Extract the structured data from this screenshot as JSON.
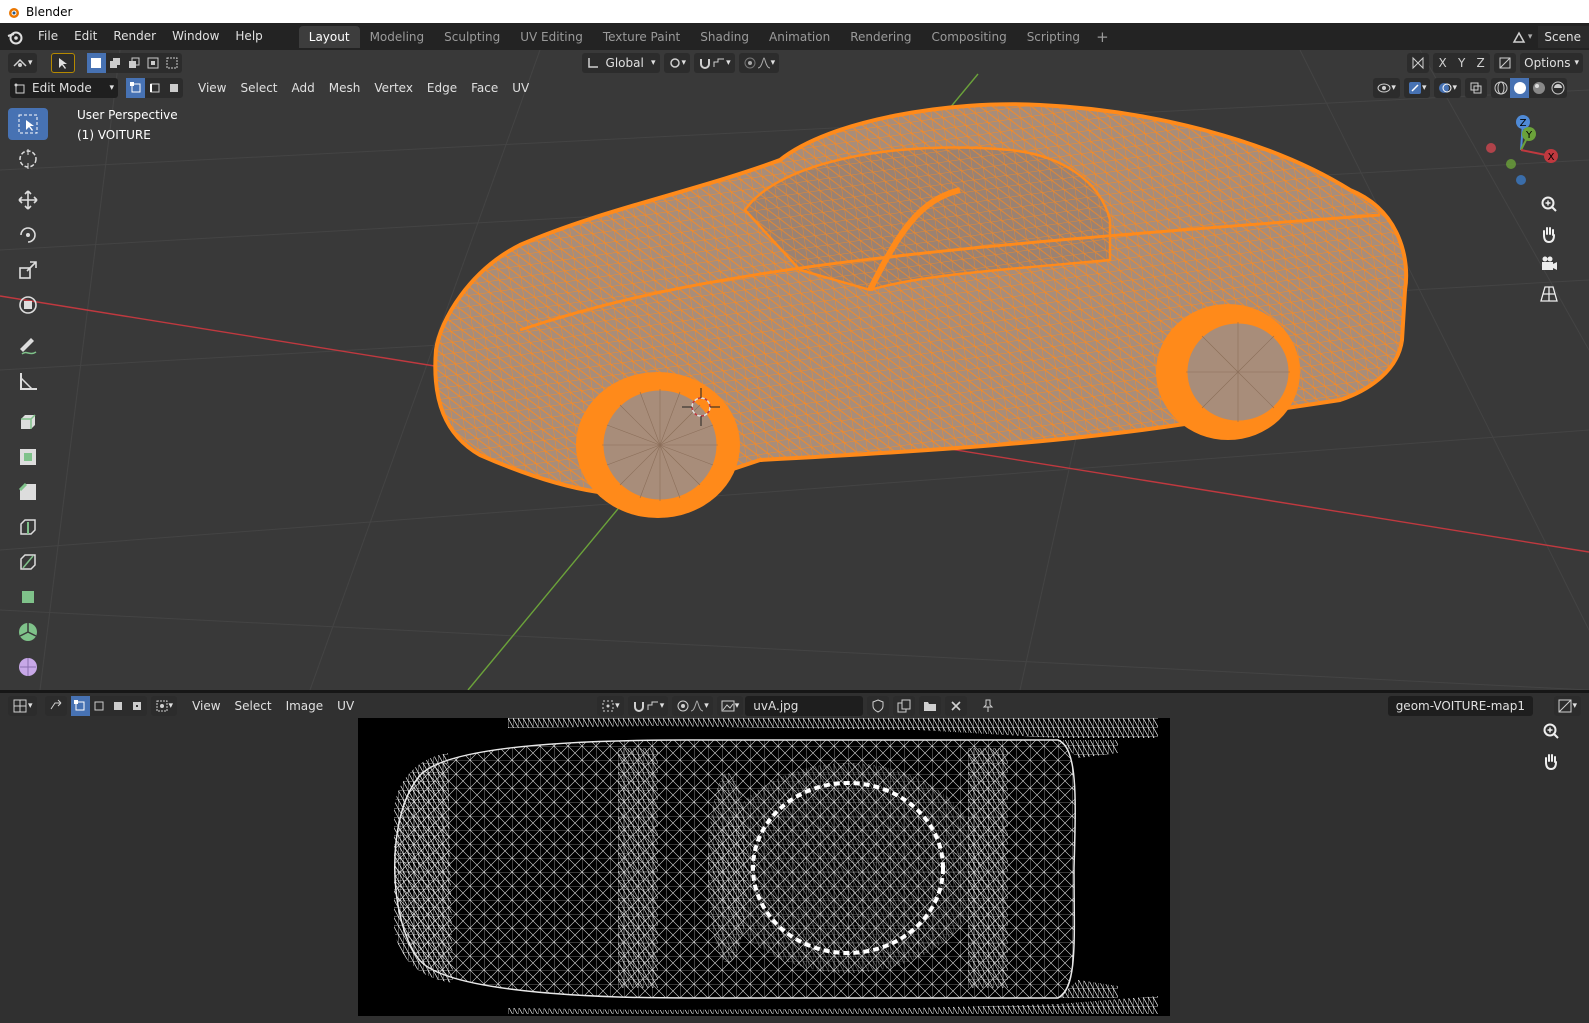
{
  "window": {
    "title": "Blender"
  },
  "menubar": {
    "items": [
      "File",
      "Edit",
      "Render",
      "Window",
      "Help"
    ],
    "workspaces": [
      "Layout",
      "Modeling",
      "Sculpting",
      "UV Editing",
      "Texture Paint",
      "Shading",
      "Animation",
      "Rendering",
      "Compositing",
      "Scripting"
    ],
    "active_workspace": "Layout",
    "add_workspace": "+",
    "scene": "Scene"
  },
  "viewport": {
    "orientation": "Global",
    "options_label": "Options",
    "axis_buttons": [
      "X",
      "Y",
      "Z"
    ],
    "mode": "Edit Mode",
    "menus": [
      "View",
      "Select",
      "Add",
      "Mesh",
      "Vertex",
      "Edge",
      "Face",
      "UV"
    ],
    "perspective": "User Perspective",
    "object": "(1) VOITURE",
    "gizmo": {
      "x": "X",
      "y": "Y",
      "z": "Z"
    },
    "colors": {
      "background": "#393939",
      "selection": "#ff8a1a",
      "mesh_fill": "#a88d7a",
      "x_axis": "#c0393f",
      "y_axis": "#6ba23a"
    }
  },
  "uv_editor": {
    "menus": [
      "View",
      "Select",
      "Image",
      "UV"
    ],
    "image_name": "uvA.jpg",
    "uv_map": "geom-VOITURE-map1"
  }
}
